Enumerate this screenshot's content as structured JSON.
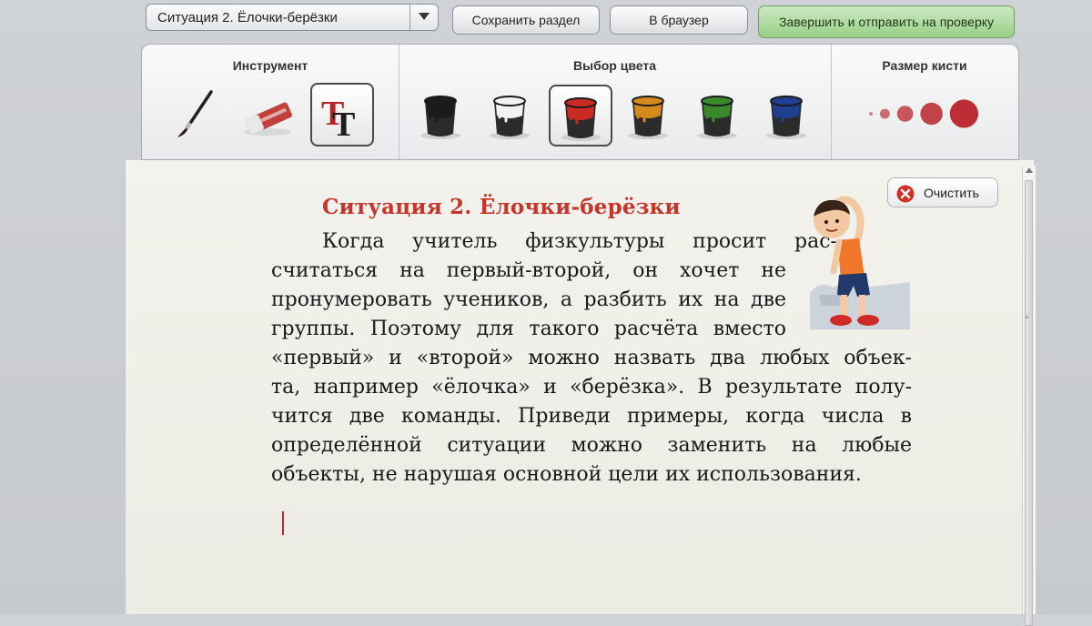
{
  "topbar": {
    "situation_select": "Ситуация 2. Ёлочки-берёзки",
    "save_label": "Сохранить раздел",
    "browser_label": "В браузер",
    "submit_label": "Завершить и отправить на проверку"
  },
  "toolbar": {
    "tool_title": "Инструмент",
    "tools": [
      "brush",
      "eraser",
      "text"
    ],
    "active_tool": "text",
    "color_title": "Выбор цвета",
    "colors": [
      "#1b1b1b",
      "#f2f2f2",
      "#c92a22",
      "#d48b1c",
      "#3a8a2c",
      "#1f3f8f"
    ],
    "active_color": "#c92a22",
    "brush_title": "Размер кисти",
    "brush_color": "#b8232a",
    "brush_sizes": 5
  },
  "content": {
    "clear_label": "Очистить",
    "heading": "Ситуация 2. Ёлочки-берёзки",
    "lines": [
      "Когда учитель физкультуры просит рас-",
      "считаться на первый-второй, он хочет не",
      "пронумеровать учеников, а разбить их на две",
      "группы. Поэтому для такого расчёта вместо",
      "«первый» и «второй» можно назвать два любых объек-",
      "та, например «ёлочка» и «берёзка». В результате полу-",
      "чится две команды. Приведи примеры, когда числа в",
      "определённой ситуации можно заменить на любые",
      "объекты, не нарушая основной цели их использования."
    ]
  }
}
